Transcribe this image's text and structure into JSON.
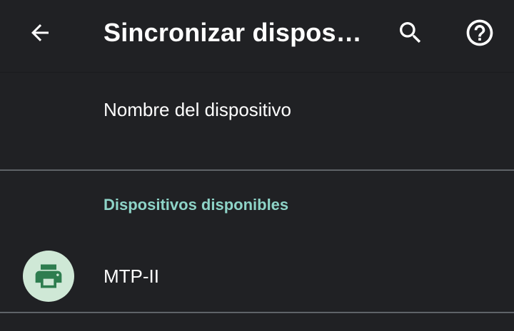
{
  "app_bar": {
    "title": "Sincronizar dispositivos",
    "back_icon": "arrow-back-icon",
    "search_icon": "search-icon",
    "help_icon": "help-circle-icon"
  },
  "settings": {
    "device_name_label": "Nombre del dispositivo"
  },
  "available_devices": {
    "header": "Dispositivos disponibles",
    "items": [
      {
        "label": "MTP-II",
        "icon": "printer-icon"
      }
    ]
  },
  "colors": {
    "background": "#202124",
    "accent": "#8ed4c8",
    "avatar_bg": "#cfe8d6",
    "printer_icon": "#2e7d4f"
  }
}
